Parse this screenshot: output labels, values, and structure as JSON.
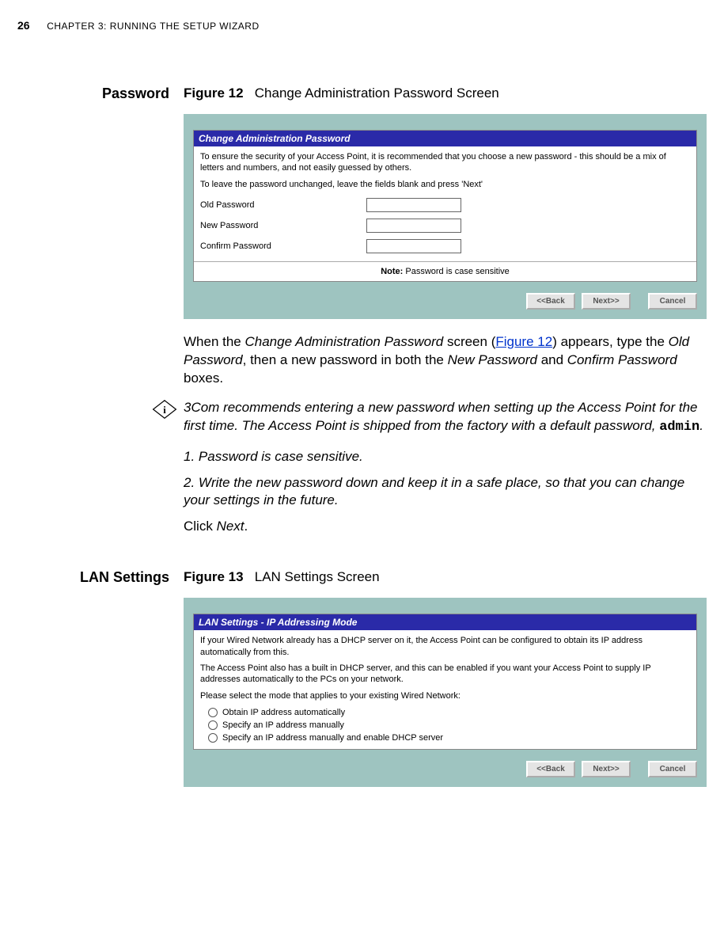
{
  "header": {
    "page_number": "26",
    "chapter": "CHAPTER 3: RUNNING THE SETUP WIZARD"
  },
  "section1": {
    "side": "Password",
    "fig_label": "Figure 12",
    "fig_title": "Change Administration Password Screen",
    "panel_title": "Change Administration Password",
    "panel_intro1": "To ensure the security of your Access Point, it is recommended that you choose a new password - this should be a mix of letters and numbers, and not easily guessed by others.",
    "panel_intro2": "To leave the password unchanged, leave the fields blank and press 'Next'",
    "fields": {
      "old": "Old Password",
      "new": "New Password",
      "confirm": "Confirm Password"
    },
    "note_label": "Note:",
    "note_text": "Password is case sensitive",
    "buttons": {
      "back": "<<Back",
      "next": "Next>>",
      "cancel": "Cancel"
    },
    "para1_a": "When the ",
    "para1_b": "Change Administration Password",
    "para1_c": " screen (",
    "para1_link": "Figure 12",
    "para1_d": ") appears, type the ",
    "para1_e": "Old Password",
    "para1_f": ", then a new password in both the ",
    "para1_g": "New Password",
    "para1_h": " and ",
    "para1_i": "Confirm Password",
    "para1_j": " boxes.",
    "info": "3Com recommends entering a new password when setting up the Access Point for the first time. The Access Point is shipped from the factory with a default password, ",
    "info_code": "admin",
    "info_end": ".",
    "li1": "1. Password is case sensitive.",
    "li2": "2. Write the new password down and keep it in a safe place, so that you can change your settings in the future.",
    "click_a": "Click ",
    "click_b": "Next",
    "click_c": "."
  },
  "section2": {
    "side": "LAN Settings",
    "fig_label": "Figure 13",
    "fig_title": "LAN Settings Screen",
    "panel_title": "LAN Settings - IP Addressing Mode",
    "p1": "If your Wired Network already has a DHCP server on it, the Access Point can be configured to obtain its IP address automatically from this.",
    "p2": "The Access Point also has a built in DHCP server, and this can be enabled if you want your Access Point to supply IP addresses automatically to the PCs on your network.",
    "p3": "Please select the mode that applies to your existing Wired Network:",
    "opt1": "Obtain IP address automatically",
    "opt2": "Specify an IP address manually",
    "opt3": "Specify an IP address manually and enable DHCP server",
    "buttons": {
      "back": "<<Back",
      "next": "Next>>",
      "cancel": "Cancel"
    }
  }
}
